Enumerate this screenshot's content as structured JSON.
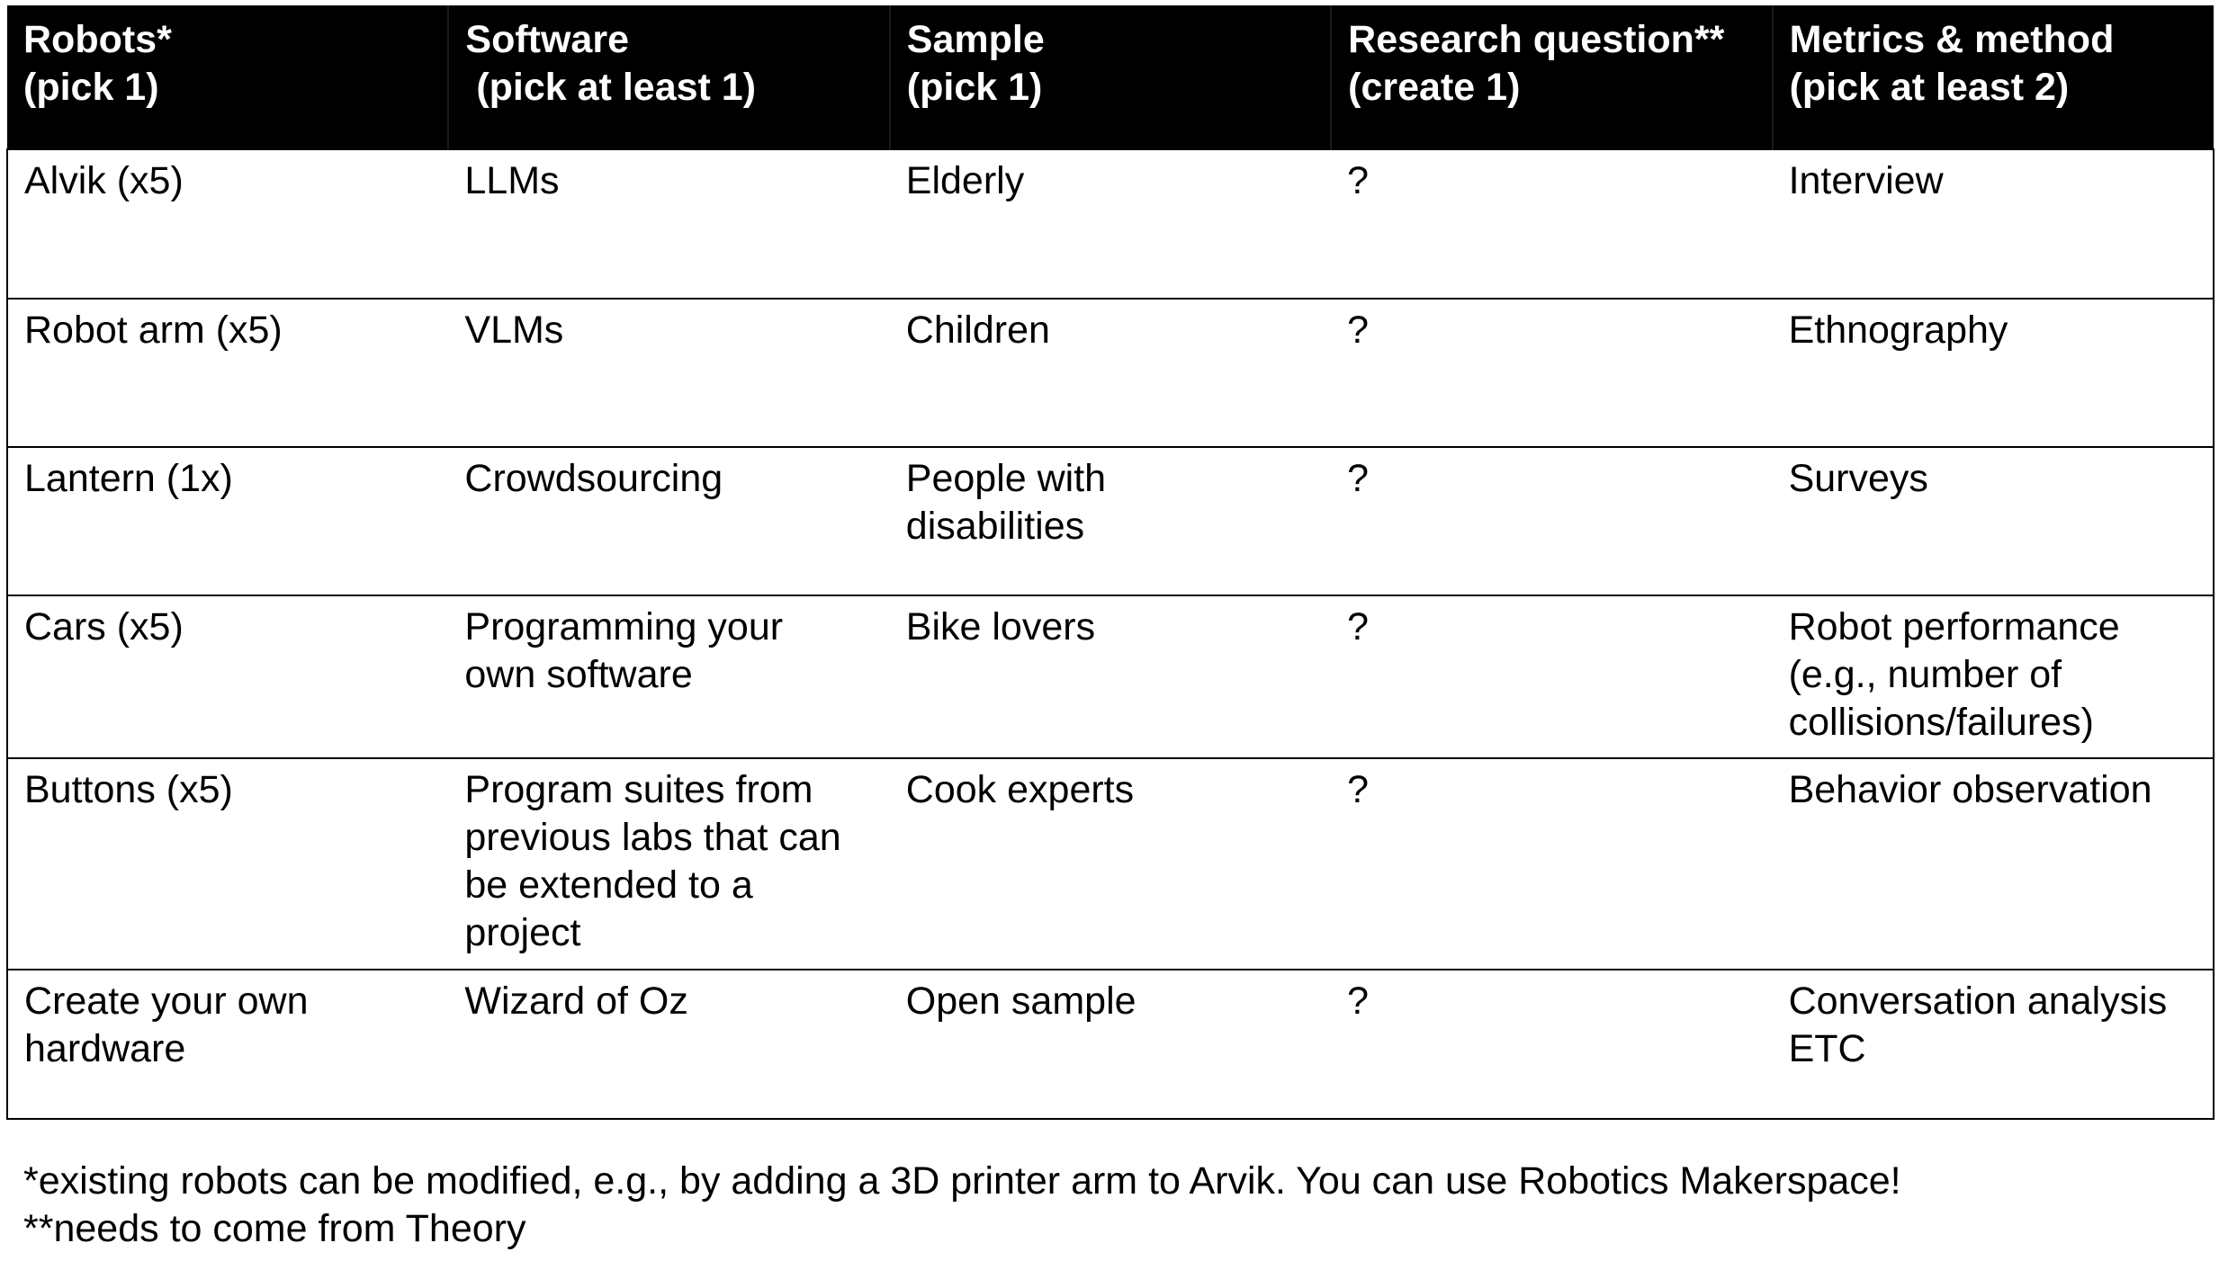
{
  "table": {
    "headers": [
      {
        "line1": "Robots*",
        "line2": "(pick 1)"
      },
      {
        "line1": "Software",
        "line2": " (pick at least 1)"
      },
      {
        "line1": "Sample",
        "line2": "(pick 1)"
      },
      {
        "line1": "Research question**",
        "line2": "(create 1)"
      },
      {
        "line1": "Metrics & method",
        "line2": "(pick at least 2)"
      }
    ],
    "rows": [
      [
        [
          "Alvik (x5)"
        ],
        [
          "LLMs"
        ],
        [
          "Elderly"
        ],
        [
          "?"
        ],
        [
          "Interview"
        ]
      ],
      [
        [
          "Robot arm (x5)"
        ],
        [
          "VLMs"
        ],
        [
          "Children"
        ],
        [
          "?"
        ],
        [
          "Ethnography"
        ]
      ],
      [
        [
          "Lantern (1x)"
        ],
        [
          "Crowdsourcing"
        ],
        [
          "People with",
          "disabilities"
        ],
        [
          "?"
        ],
        [
          "Surveys"
        ]
      ],
      [
        [
          "Cars (x5)"
        ],
        [
          "Programming your",
          "own software"
        ],
        [
          "Bike lovers"
        ],
        [
          "?"
        ],
        [
          "Robot performance",
          "(e.g., number of",
          "collisions/failures)"
        ]
      ],
      [
        [
          "Buttons (x5)"
        ],
        [
          "Program suites from",
          "previous labs that can",
          "be extended to a",
          "project"
        ],
        [
          "Cook experts"
        ],
        [
          "?"
        ],
        [
          "Behavior observation"
        ]
      ],
      [
        [
          "Create your own",
          "hardware"
        ],
        [
          "Wizard of Oz"
        ],
        [
          "Open sample"
        ],
        [
          "?"
        ],
        [
          "Conversation analysis",
          "ETC"
        ]
      ]
    ]
  },
  "footnotes": {
    "note1": "*existing robots can be modified, e.g., by adding a 3D printer arm to Arvik. You can use Robotics Makerspace!",
    "note2": "**needs to come from Theory"
  }
}
